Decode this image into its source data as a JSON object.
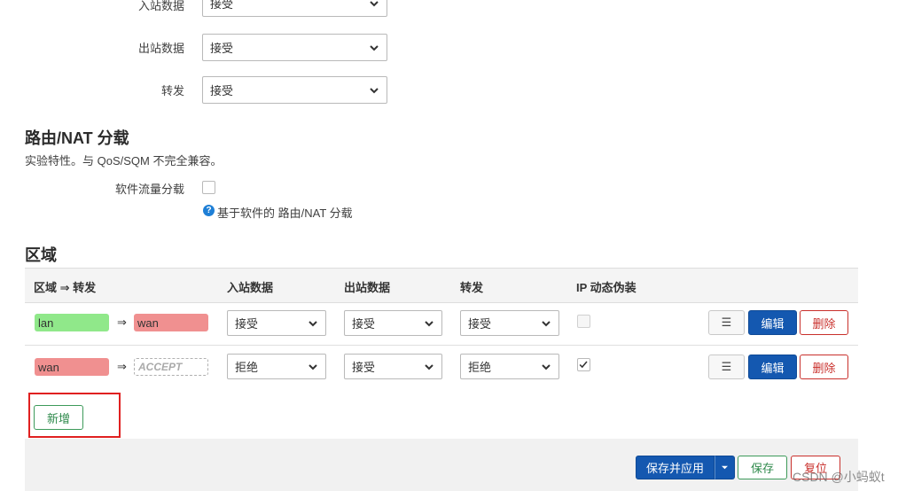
{
  "defaults": {
    "input_label": "入站数据",
    "input_value": "接受",
    "output_label": "出站数据",
    "output_value": "接受",
    "forward_label": "转发",
    "forward_value": "接受"
  },
  "offload": {
    "title": "路由/NAT 分载",
    "description": "实验特性。与 QoS/SQM 不完全兼容。",
    "sw_label": "软件流量分载",
    "sw_checked": false,
    "help_text": "基于软件的 路由/NAT 分载"
  },
  "zones": {
    "title": "区域",
    "headers": {
      "zone_forward": "区域 ⇒ 转发",
      "input": "入站数据",
      "output": "出站数据",
      "forward": "转发",
      "masq": "IP 动态伪装"
    },
    "rows": [
      {
        "zone": "lan",
        "zone_color": "#90e88a",
        "arrow": "⇒",
        "dest": "wan",
        "dest_color": "#f09090",
        "dest_dashed": false,
        "input": "接受",
        "output": "接受",
        "forward": "接受",
        "masq": false
      },
      {
        "zone": "wan",
        "zone_color": "#f09090",
        "arrow": "⇒",
        "dest": "ACCEPT",
        "dest_color": "#ffffff",
        "dest_dashed": true,
        "input": "拒绝",
        "output": "接受",
        "forward": "拒绝",
        "masq": true
      }
    ],
    "row_buttons": {
      "menu": "☰",
      "edit": "编辑",
      "delete": "删除"
    },
    "add_label": "新增",
    "highlight_color": "#e02020"
  },
  "footer": {
    "save_apply": "保存并应用",
    "save": "保存",
    "reset": "复位"
  },
  "watermark": "CSDN @小蚂蚁t"
}
